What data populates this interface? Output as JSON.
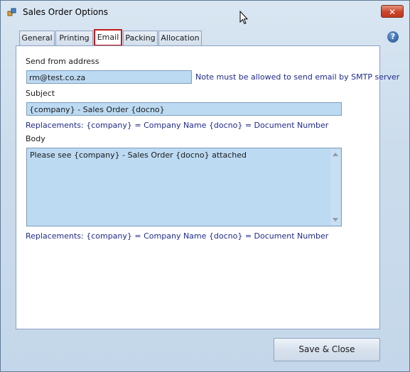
{
  "window": {
    "title": "Sales Order Options",
    "close_glyph": "✕",
    "help_glyph": "?"
  },
  "tabs": [
    {
      "label": "General"
    },
    {
      "label": "Printing"
    },
    {
      "label": "Email"
    },
    {
      "label": "Packing"
    },
    {
      "label": "Allocation"
    }
  ],
  "active_tab": "Email",
  "email": {
    "send_from_label": "Send from address",
    "send_from_value": "rm@test.co.za",
    "smtp_note": "Note must be allowed to send email by SMTP server",
    "subject_label": "Subject",
    "subject_value": "{company} - Sales Order {docno}",
    "subject_replacements": "Replacements: {company} = Company Name  {docno} = Document Number",
    "body_label": "Body",
    "body_value": "Please see {company} - Sales Order {docno} attached",
    "body_replacements": "Replacements: {company} = Company Name  {docno} = Document Number"
  },
  "footer": {
    "save_close_label": "Save & Close"
  },
  "colors": {
    "field_background": "#bcdaf2",
    "note_text": "#1f2a8c",
    "active_tab_border": "#c21a1a",
    "close_button": "#c9432a"
  }
}
